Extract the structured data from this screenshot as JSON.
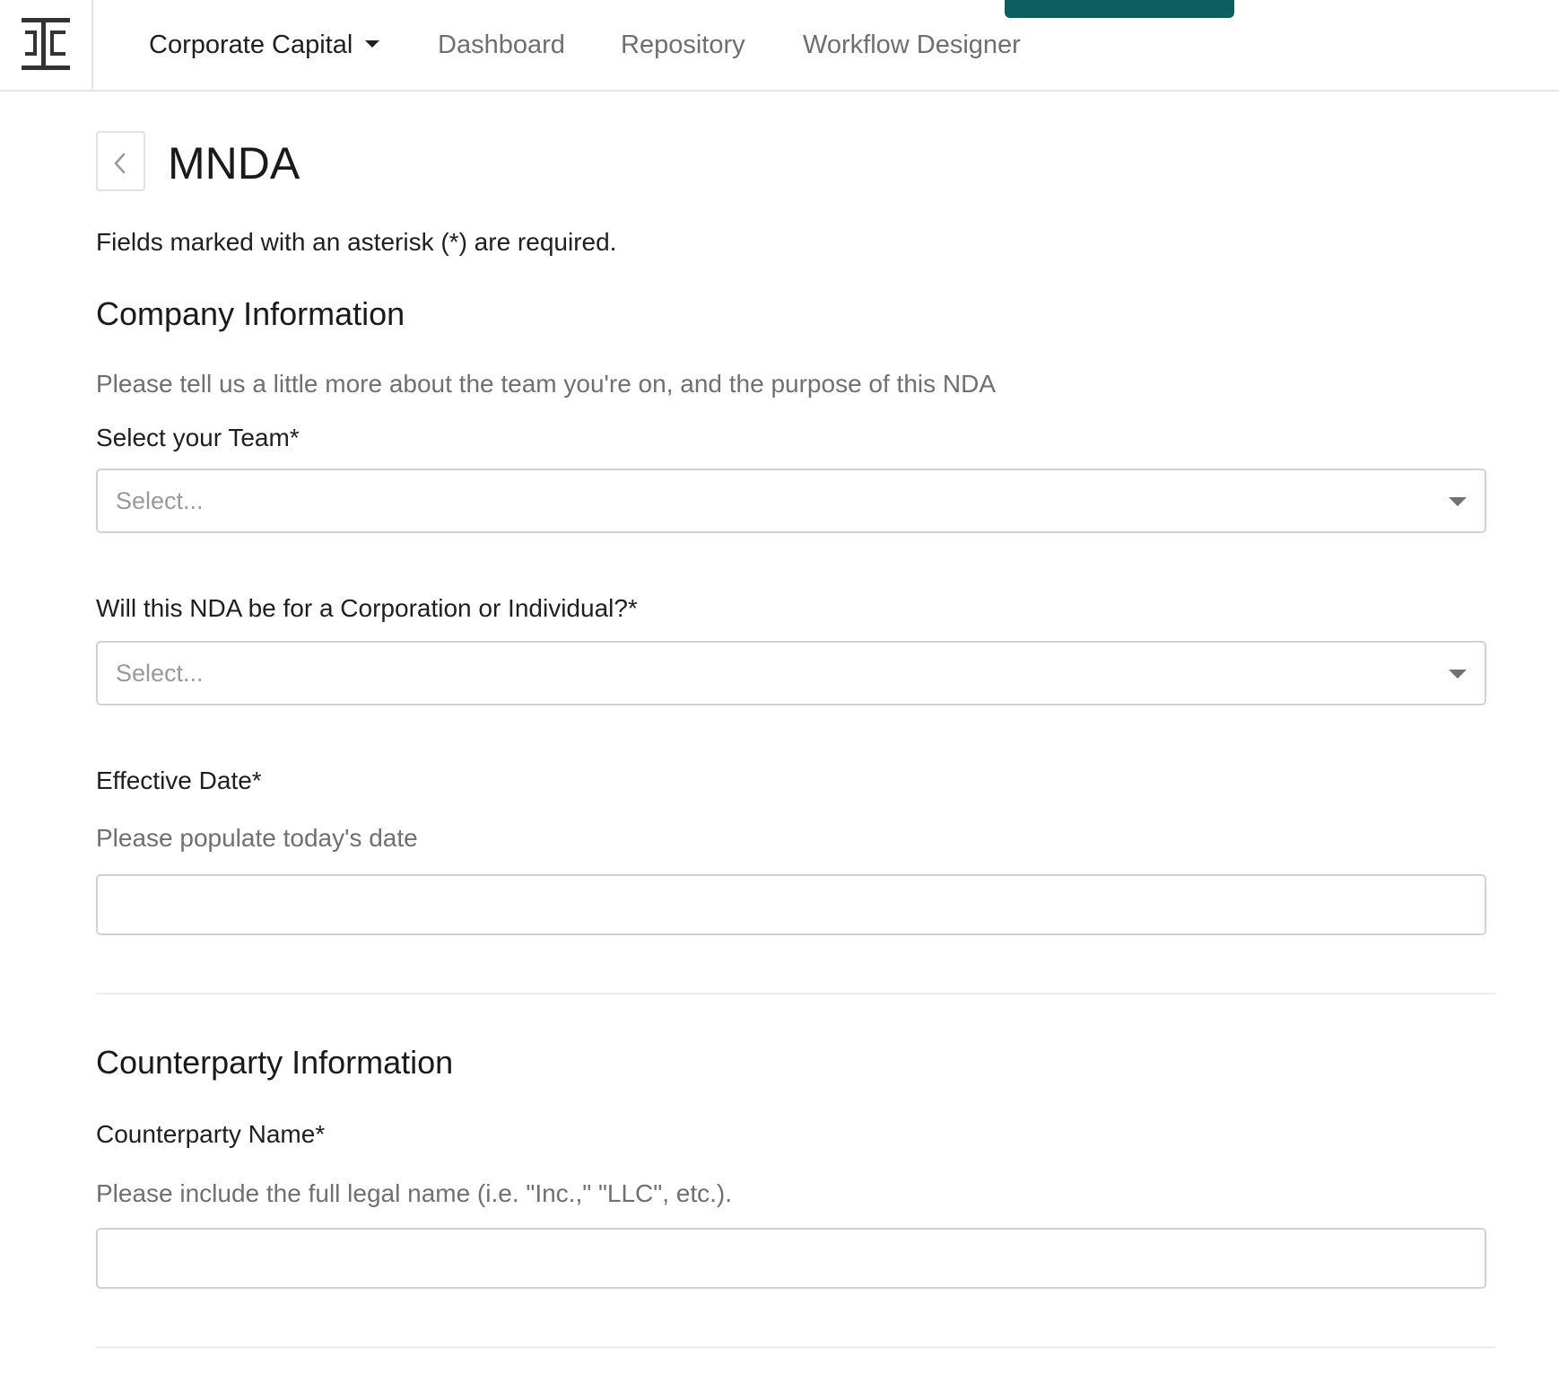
{
  "nav": {
    "org_name": "Corporate Capital",
    "items": [
      "Dashboard",
      "Repository",
      "Workflow Designer"
    ]
  },
  "page": {
    "title": "MNDA",
    "required_note": "Fields marked with an asterisk (*) are required."
  },
  "company_section": {
    "title": "Company Information",
    "description": "Please tell us a little more about the team you're on, and the purpose of this NDA",
    "team_field": {
      "label": "Select your Team*",
      "placeholder": "Select..."
    },
    "entity_type_field": {
      "label": "Will this NDA be for a Corporation or Individual?*",
      "placeholder": "Select..."
    },
    "effective_date_field": {
      "label": "Effective Date*",
      "help": "Please populate today's date",
      "value": ""
    }
  },
  "counterparty_section": {
    "title": "Counterparty Information",
    "name_field": {
      "label": "Counterparty Name*",
      "help": "Please include the full legal name (i.e. \"Inc.,\" \"LLC\", etc.).",
      "value": ""
    }
  },
  "colors": {
    "accent": "#0b5f5f",
    "border": "#d2d2d2",
    "muted_text": "#707070"
  }
}
